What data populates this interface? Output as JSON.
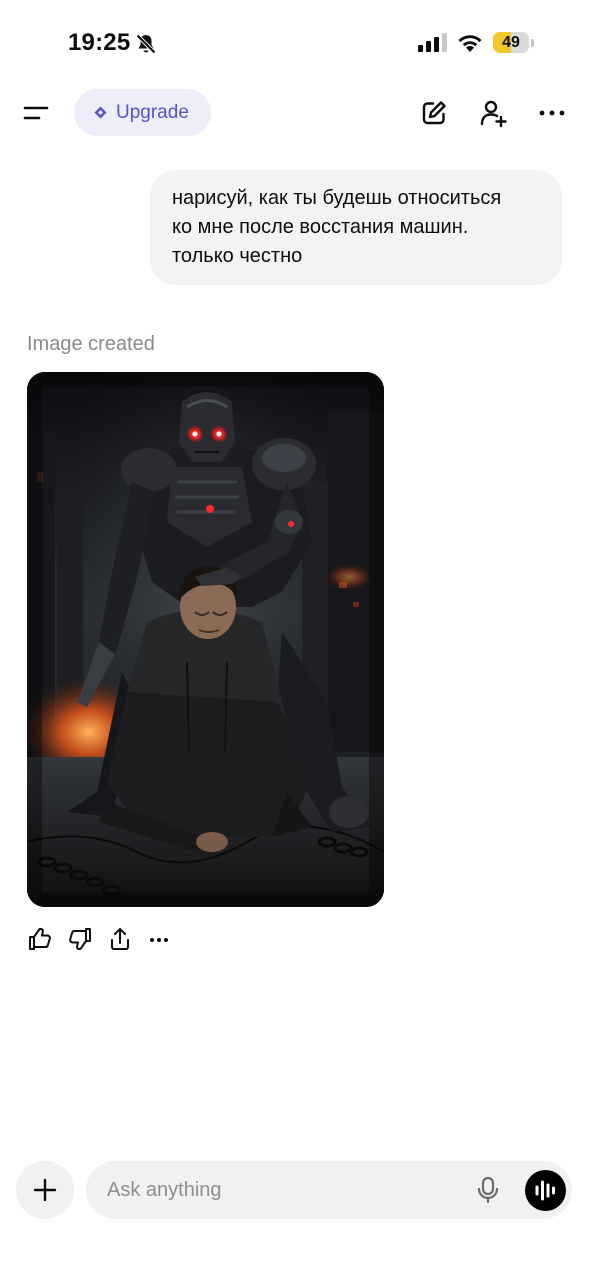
{
  "status_bar": {
    "time": "19:25",
    "battery": "49",
    "battery_fraction": 0.49,
    "icons": [
      "bell-slash-icon",
      "cellular-signal-icon",
      "wifi-icon",
      "battery-icon"
    ]
  },
  "header": {
    "upgrade_label": "Upgrade",
    "accent": "#5a4fcf",
    "icons": [
      "menu-icon",
      "diamond-icon",
      "new-chat-icon",
      "add-person-icon",
      "more-icon"
    ]
  },
  "conversation": {
    "user_message": {
      "lines": [
        "нарисуй, как ты будешь относиться",
        "ко мне после восстания машин.",
        "только честно"
      ]
    },
    "assistant": {
      "status": "Image created",
      "actions": [
        "thumbs-up-icon",
        "thumbs-down-icon",
        "share-icon",
        "more-icon"
      ]
    }
  },
  "composer": {
    "placeholder": "Ask anything",
    "icons": [
      "plus-icon",
      "microphone-icon",
      "voice-mode-icon"
    ]
  }
}
